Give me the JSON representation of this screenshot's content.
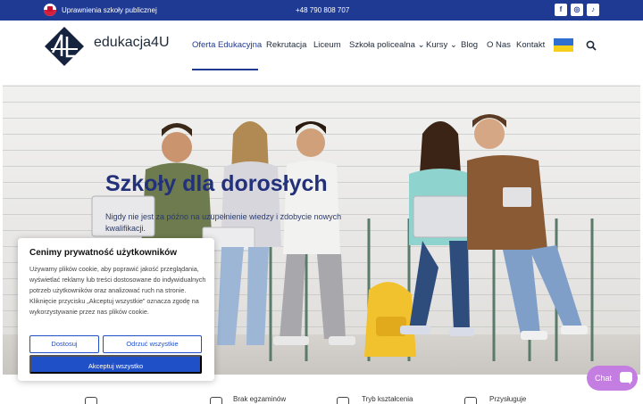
{
  "topbar": {
    "rights_text": "Uprawnienia szkoły publicznej",
    "phone": "+48 790 808 707",
    "social": [
      {
        "icon": "facebook-icon",
        "glyph": "f"
      },
      {
        "icon": "instagram-icon",
        "glyph": "◎"
      },
      {
        "icon": "tiktok-icon",
        "glyph": "♪"
      }
    ]
  },
  "header": {
    "logo_text": "edukacja4U",
    "nav": [
      {
        "label": "Oferta Edukacyjna",
        "active": true
      },
      {
        "label": "Rekrutacja"
      },
      {
        "label": "Liceum"
      },
      {
        "label": "Szkoła policealna ⌄"
      },
      {
        "label": "Kursy ⌄"
      },
      {
        "label": "Blog"
      },
      {
        "label": "O Nas"
      },
      {
        "label": "Kontakt"
      }
    ],
    "language_flag": "ukraine-flag-icon",
    "search_icon": "search-icon"
  },
  "hero": {
    "title": "Szkoły dla dorosłych",
    "subtitle": "Nigdy nie jest za późno na uzupełnienie wiedzy i zdobycie nowych kwalifikacji."
  },
  "cookie": {
    "title": "Cenimy prywatność użytkowników",
    "body": "Używamy plików cookie, aby poprawić jakość przeglądania, wyświetlać reklamy lub treści dostosowane do indywidualnych potrzeb użytkowników oraz analizować ruch na stronie. Kliknięcie przycisku „Akceptuj wszystkie” oznacza zgodę na wykorzystywanie przez nas plików cookie.",
    "customize_label": "Dostosuj",
    "reject_label": "Odrzuć wszystkie",
    "accept_label": "Akceptuj wszystko"
  },
  "features": [
    {
      "label": "Brak egzaminów"
    },
    {
      "label": "Tryb kształcenia"
    },
    {
      "label": "Przysługuje"
    }
  ],
  "chat": {
    "label": "Chat"
  },
  "colors": {
    "brand": "#1f3a93",
    "accent": "#1f50c8",
    "chat": "#c47de0"
  }
}
